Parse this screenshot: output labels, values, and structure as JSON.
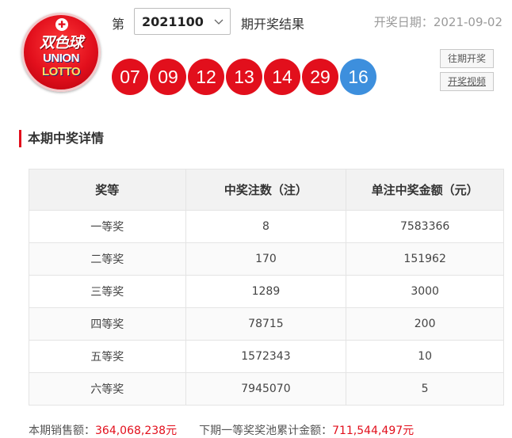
{
  "logo": {
    "cn": "双色球",
    "en_line1": "UNION",
    "en_line2": "LOTTO"
  },
  "header": {
    "issue_prefix": "第",
    "issue_value": "2021100",
    "issue_suffix": "期开奖结果",
    "date_label": "开奖日期：",
    "date_value": "2021-09-02"
  },
  "balls": {
    "red": [
      "07",
      "09",
      "12",
      "13",
      "14",
      "29"
    ],
    "blue": "16"
  },
  "buttons": {
    "history": "往期开奖",
    "video": "开奖视频"
  },
  "section_title": "本期中奖详情",
  "table": {
    "headers": [
      "奖等",
      "中奖注数（注）",
      "单注中奖金额（元）"
    ],
    "rows": [
      [
        "一等奖",
        "8",
        "7583366"
      ],
      [
        "二等奖",
        "170",
        "151962"
      ],
      [
        "三等奖",
        "1289",
        "3000"
      ],
      [
        "四等奖",
        "78715",
        "200"
      ],
      [
        "五等奖",
        "1572343",
        "10"
      ],
      [
        "六等奖",
        "7945070",
        "5"
      ]
    ]
  },
  "footer": {
    "sales_label": "本期销售额：",
    "sales_value": "364,068,238元",
    "pool_label": "下期一等奖奖池累计金额：",
    "pool_value": "711,544,497元"
  },
  "colors": {
    "red": "#e20f1c",
    "blue": "#3d8fdd",
    "accent_gray": "#9a9a9a"
  },
  "icons": {
    "select_arrow": "chevron-down-icon"
  }
}
